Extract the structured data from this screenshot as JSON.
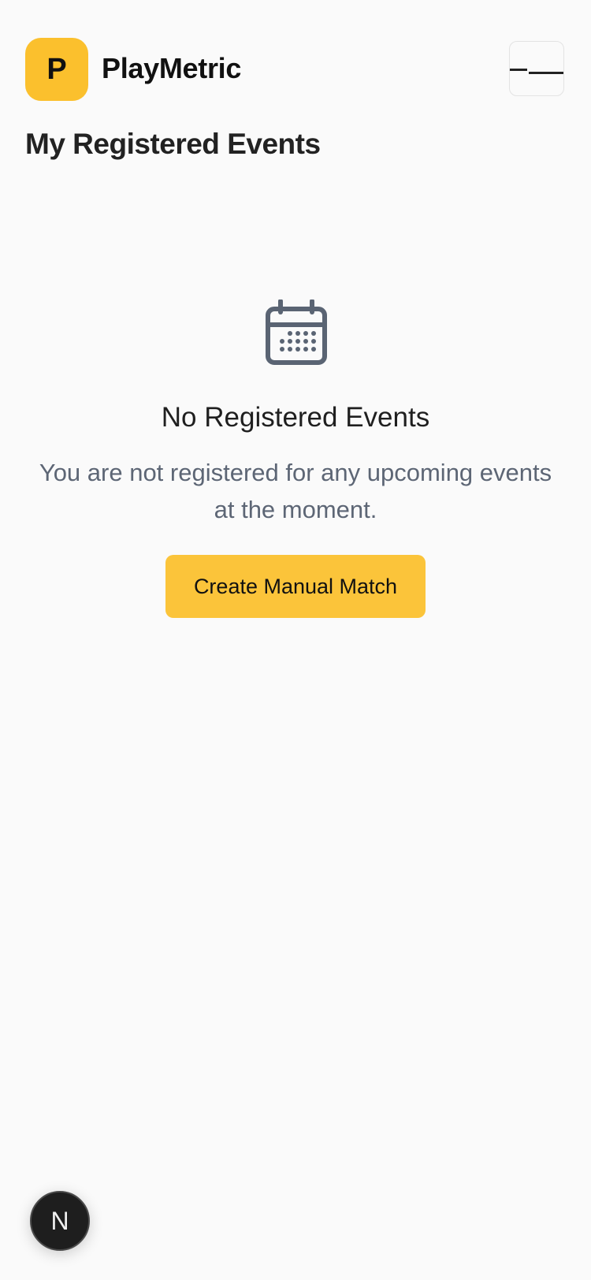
{
  "header": {
    "logo_letter": "P",
    "brand_name": "PlayMetric",
    "menu_icon": "hamburger-menu-icon"
  },
  "page": {
    "title": "My Registered Events"
  },
  "empty_state": {
    "icon": "calendar-icon",
    "title": "No Registered Events",
    "description": "You are not registered for any upcoming events at the moment.",
    "button_label": "Create Manual Match"
  },
  "dev_badge": {
    "letter": "N"
  },
  "colors": {
    "accent": "#fbc43a",
    "background": "#fafafa",
    "muted_text": "#5d6675",
    "icon_gray": "#5a6473"
  }
}
